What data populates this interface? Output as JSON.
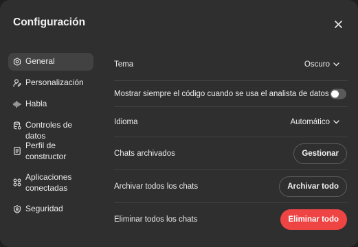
{
  "dialog": {
    "title": "Configuración"
  },
  "sidebar": {
    "items": [
      {
        "label": "General",
        "icon": "gear-icon",
        "active": true
      },
      {
        "label": "Personalización",
        "icon": "person-icon"
      },
      {
        "label": "Habla",
        "icon": "waveform-icon"
      },
      {
        "label": "Controles de datos",
        "icon": "database-icon"
      },
      {
        "label_line1": "Perfil de",
        "label_line2": "constructor",
        "icon": "id-card-icon"
      },
      {
        "label_line1": "Aplicaciones",
        "label_line2": "conectadas",
        "icon": "apps-grid-icon"
      },
      {
        "label": "Seguridad",
        "icon": "shield-icon"
      }
    ]
  },
  "settings": {
    "theme": {
      "label": "Tema",
      "value": "Oscuro"
    },
    "show_code": {
      "label": "Mostrar siempre el código cuando se usa el analista de datos",
      "enabled": false
    },
    "language": {
      "label": "Idioma",
      "value": "Automático"
    },
    "archived_chats": {
      "label": "Chats archivados",
      "button": "Gestionar"
    },
    "archive_all": {
      "label": "Archivar todos los chats",
      "button": "Archivar todo"
    },
    "delete_all": {
      "label": "Eliminar todos los chats",
      "button": "Eliminar todo"
    }
  },
  "colors": {
    "background": "#2f2f2f",
    "sidebar_active": "#424242",
    "danger": "#ef4444",
    "text": "#ececec"
  }
}
